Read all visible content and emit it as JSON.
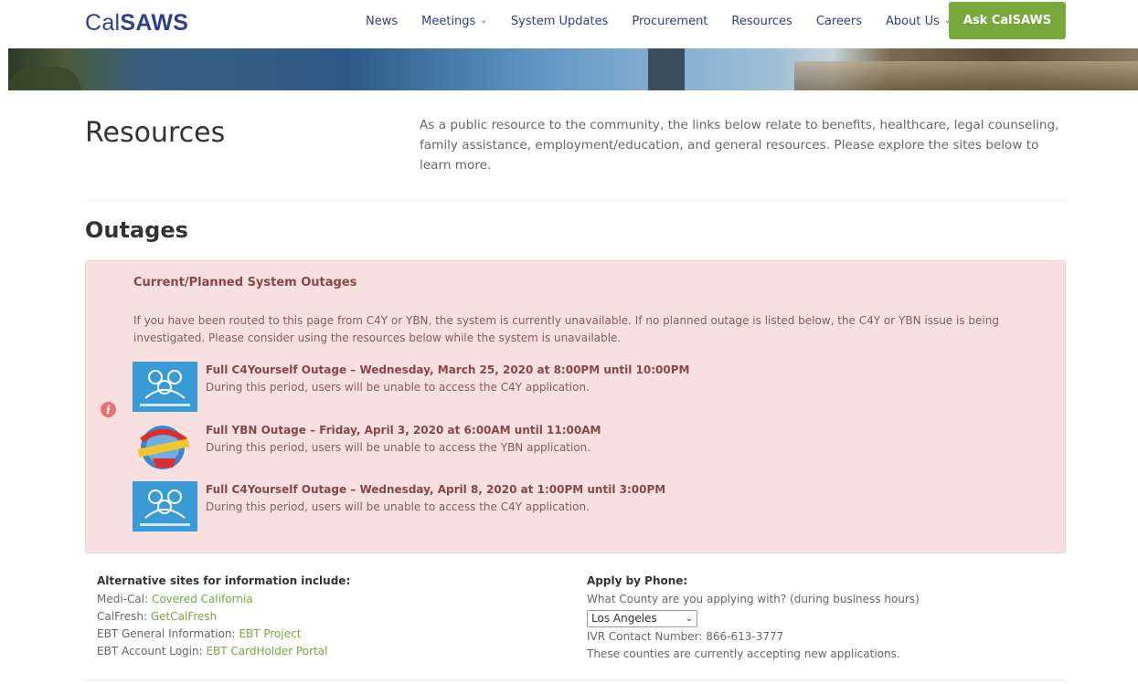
{
  "header": {
    "logo_light": "Cal",
    "logo_bold": "SAWS",
    "nav": [
      {
        "label": "News",
        "dropdown": false
      },
      {
        "label": "Meetings",
        "dropdown": true
      },
      {
        "label": "System Updates",
        "dropdown": false
      },
      {
        "label": "Procurement",
        "dropdown": false
      },
      {
        "label": "Resources",
        "dropdown": false
      },
      {
        "label": "Careers",
        "dropdown": false
      },
      {
        "label": "About Us",
        "dropdown": true
      }
    ],
    "cta_label": "Ask CalSAWS",
    "colors": {
      "brand": "#2e3f8c",
      "cta": "#76a83c"
    }
  },
  "intro": {
    "title": "Resources",
    "description": "As a public resource to the community, the links below relate to benefits, healthcare, legal counseling, family assistance, employment/education, and general resources. Please explore the sites below to learn more."
  },
  "outages": {
    "section_title": "Outages",
    "alert_icon": "info-icon",
    "box_title": "Current/Planned System Outages",
    "box_text": "If you have been routed to this page from C4Y or YBN, the system is currently unavailable. If no planned outage is listed below, the C4Y or YBN issue is being investigated. Please consider using the resources below while the system is unavailable.",
    "items": [
      {
        "logo": "c4yourself-logo",
        "title": "Full C4Yourself Outage – Wednesday, March 25, 2020 at 8:00PM until 10:00PM",
        "desc": "During this period, users will be unable to access the C4Y application."
      },
      {
        "logo": "ybn-logo",
        "title": "Full YBN Outage – Friday, April 3, 2020 at 6:00AM until 11:00AM",
        "desc": "During this period, users will be unable to access the YBN application."
      },
      {
        "logo": "c4yourself-logo",
        "title": "Full C4Yourself Outage – Wednesday, April 8, 2020 at 1:00PM until 3:00PM",
        "desc": "During this period, users will be unable to access the C4Y application."
      }
    ],
    "colors": {
      "box_bg": "#f9e0e0",
      "text": "#8a4646"
    }
  },
  "alternatives": {
    "title": "Alternative sites for information include:",
    "rows": [
      {
        "label": "Medi-Cal: ",
        "link": "Covered California"
      },
      {
        "label": "CalFresh: ",
        "link": "GetCalFresh"
      },
      {
        "label": "EBT General Information: ",
        "link": "EBT Project"
      },
      {
        "label": "EBT Account Login: ",
        "link": "EBT CardHolder Portal"
      }
    ]
  },
  "phone": {
    "title": "Apply by Phone:",
    "question": "What County are you applying with? (during business hours)",
    "county_selected": "Los Angeles",
    "ivr_text": "IVR Contact Number: 866-613-3777",
    "note": "These counties are currently accepting new applications."
  }
}
